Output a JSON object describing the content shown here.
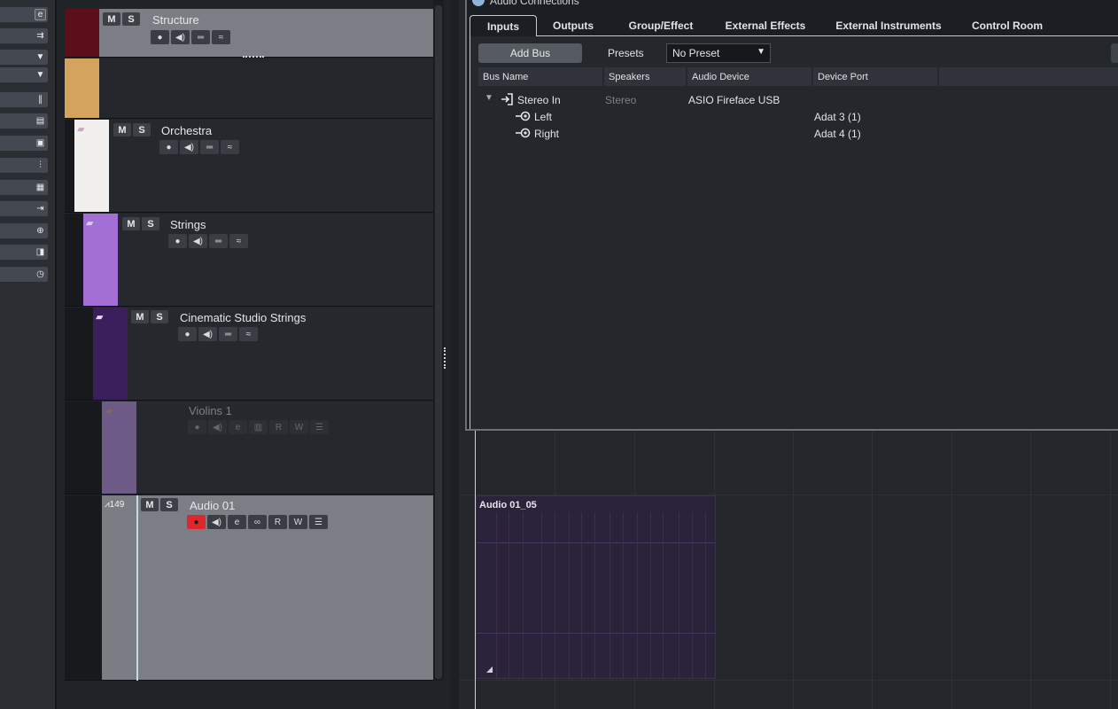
{
  "inspector": {
    "rows": [
      {
        "icon": "edit-icon",
        "glyph": "e"
      },
      {
        "icon": "routing-icon",
        "glyph": "⇉"
      },
      {
        "icon": "dropdown-arrow-icon",
        "glyph": "▼"
      },
      {
        "icon": "dropdown-arrow-icon",
        "glyph": "▼"
      },
      {
        "icon": "waveform-icon",
        "glyph": "∥"
      },
      {
        "icon": "panel-icon",
        "glyph": "▤"
      },
      {
        "icon": "insert-icon",
        "glyph": "▣"
      },
      {
        "icon": "eq-icon",
        "glyph": "⫶"
      },
      {
        "icon": "sends-icon",
        "glyph": "▦"
      },
      {
        "icon": "input-icon",
        "glyph": "⇥"
      },
      {
        "icon": "fader-icon",
        "glyph": "⊕"
      },
      {
        "icon": "channel-icon",
        "glyph": "◨"
      },
      {
        "icon": "clock-icon",
        "glyph": "◷"
      }
    ]
  },
  "tracks": [
    {
      "name": "Structure",
      "mute": "M",
      "solo": "S",
      "color": "#5a0f1b"
    },
    {
      "name": "",
      "color": "#d4a45e"
    },
    {
      "name": "Orchestra",
      "mute": "M",
      "solo": "S",
      "color": "#f2f0ee"
    },
    {
      "name": "Strings",
      "mute": "M",
      "solo": "S",
      "color": "#a36fd4"
    },
    {
      "name": "Cinematic Studio Strings",
      "mute": "M",
      "solo": "S",
      "color": "#3b1f5c"
    },
    {
      "name": "Violins 1",
      "color": "#6d5a87"
    },
    {
      "name": "Audio 01",
      "mute": "M",
      "solo": "S",
      "number": "149",
      "color": "#7a7e84",
      "buttons": {
        "read": "R",
        "write": "W"
      }
    }
  ],
  "violins_buttons": {
    "read": "R",
    "write": "W"
  },
  "dialog": {
    "title": "Audio Connections",
    "tabs": [
      "Inputs",
      "Outputs",
      "Group/Effect",
      "External Effects",
      "External Instruments",
      "Control Room"
    ],
    "active_tab": "Inputs",
    "add_bus_label": "Add Bus",
    "presets_label": "Presets",
    "preset_value": "No Preset",
    "columns": [
      "Bus Name",
      "Speakers",
      "Audio Device",
      "Device Port"
    ],
    "rows": [
      {
        "bus": "Stereo In",
        "speakers": "Stereo",
        "device": "ASIO Fireface USB",
        "port": ""
      },
      {
        "bus": "Left",
        "speakers": "",
        "device": "",
        "port": "Adat 3 (1)"
      },
      {
        "bus": "Right",
        "speakers": "",
        "device": "",
        "port": "Adat 4 (1)"
      }
    ]
  },
  "event": {
    "title": "Audio 01_05"
  },
  "colors": {
    "record_active": "#e0262b",
    "accent": "#c8ccd1"
  }
}
